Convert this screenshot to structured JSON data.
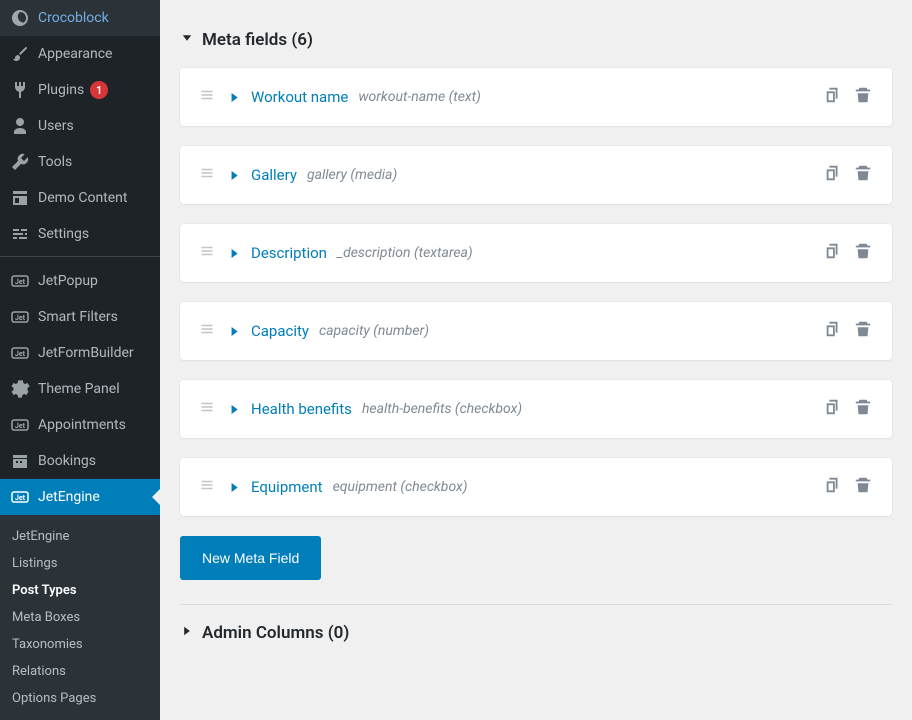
{
  "sidebar": {
    "menu": [
      {
        "label": "Crocoblock",
        "icon": "croco"
      },
      {
        "label": "Appearance",
        "icon": "brush"
      },
      {
        "label": "Plugins",
        "icon": "plug",
        "badge": "1"
      },
      {
        "label": "Users",
        "icon": "user"
      },
      {
        "label": "Tools",
        "icon": "wrench"
      },
      {
        "label": "Demo Content",
        "icon": "demo"
      },
      {
        "label": "Settings",
        "icon": "sliders"
      }
    ],
    "menu2": [
      {
        "label": "JetPopup",
        "icon": "jet"
      },
      {
        "label": "Smart Filters",
        "icon": "jet"
      },
      {
        "label": "JetFormBuilder",
        "icon": "jet"
      },
      {
        "label": "Theme Panel",
        "icon": "gear"
      },
      {
        "label": "Appointments",
        "icon": "jet"
      },
      {
        "label": "Bookings",
        "icon": "bookings"
      },
      {
        "label": "JetEngine",
        "icon": "jet",
        "active": true
      }
    ],
    "submenu": [
      {
        "label": "JetEngine"
      },
      {
        "label": "Listings"
      },
      {
        "label": "Post Types",
        "current": true
      },
      {
        "label": "Meta Boxes"
      },
      {
        "label": "Taxonomies"
      },
      {
        "label": "Relations"
      },
      {
        "label": "Options Pages"
      }
    ]
  },
  "main": {
    "section_title": "Meta fields (6)",
    "fields": [
      {
        "label": "Workout name",
        "meta": "workout-name (text)"
      },
      {
        "label": "Gallery",
        "meta": "gallery (media)"
      },
      {
        "label": "Description",
        "meta": "_description (textarea)"
      },
      {
        "label": "Capacity",
        "meta": "capacity (number)"
      },
      {
        "label": "Health benefits",
        "meta": "health-benefits (checkbox)"
      },
      {
        "label": "Equipment",
        "meta": "equipment (checkbox)"
      }
    ],
    "new_field_button": "New Meta Field",
    "admin_columns_title": "Admin Columns (0)"
  }
}
